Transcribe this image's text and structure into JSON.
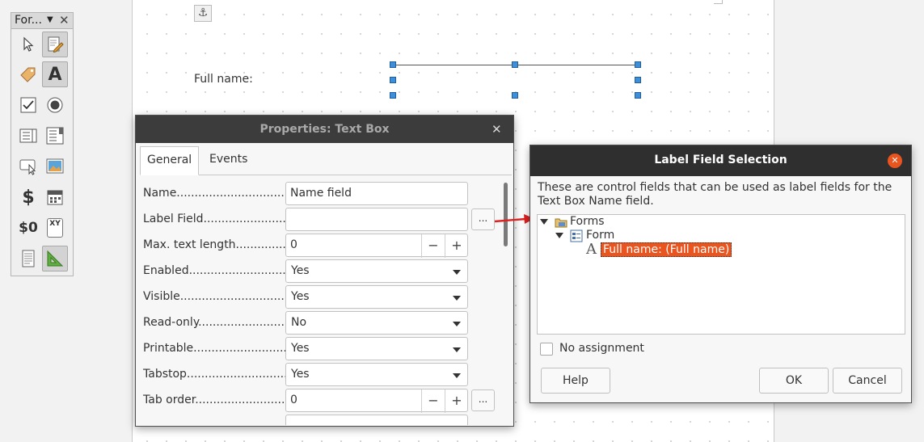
{
  "document": {
    "anchor_icon": "anchor-icon",
    "label_text": "Full name:"
  },
  "form_toolbar": {
    "title": "For...",
    "tools": [
      {
        "name": "select-icon",
        "pressed": false
      },
      {
        "name": "design-mode-icon",
        "pressed": true
      },
      {
        "name": "control-wizard-icon",
        "pressed": false
      },
      {
        "name": "label-icon",
        "pressed": true
      },
      {
        "name": "checkbox-icon",
        "pressed": false
      },
      {
        "name": "option-button-icon",
        "pressed": false
      },
      {
        "name": "list-box-icon",
        "pressed": false
      },
      {
        "name": "combo-box-icon",
        "pressed": false
      },
      {
        "name": "push-button-icon",
        "pressed": false
      },
      {
        "name": "image-button-icon",
        "pressed": false
      },
      {
        "name": "currency-field-icon",
        "pressed": false
      },
      {
        "name": "date-field-icon",
        "pressed": false
      },
      {
        "name": "numeric-field-icon",
        "pressed": false
      },
      {
        "name": "table-control-icon",
        "pressed": false
      },
      {
        "name": "form-properties-icon",
        "pressed": false
      },
      {
        "name": "navigator-icon",
        "pressed": true
      }
    ],
    "glyphs": {
      "currency": "$",
      "numeric": "$0",
      "xy": "XY"
    }
  },
  "properties_dialog": {
    "title": "Properties: Text Box",
    "tabs": [
      "General",
      "Events"
    ],
    "rows": [
      {
        "label": "Name.................................",
        "value": "Name field",
        "kind": "text"
      },
      {
        "label": "Label Field...........................",
        "value": "",
        "kind": "text-dots"
      },
      {
        "label": "Max. text length...............",
        "value": "0",
        "kind": "spin"
      },
      {
        "label": "Enabled.............................",
        "value": "Yes",
        "kind": "combo"
      },
      {
        "label": "Visible................................",
        "value": "Yes",
        "kind": "combo"
      },
      {
        "label": "Read-only...........................",
        "value": "No",
        "kind": "combo"
      },
      {
        "label": "Printable............................",
        "value": "Yes",
        "kind": "combo"
      },
      {
        "label": "Tabstop..............................",
        "value": "Yes",
        "kind": "combo"
      },
      {
        "label": "Tab order.............................",
        "value": "0",
        "kind": "spin-dots"
      }
    ],
    "dots_label": "...",
    "minus": "−",
    "plus": "+"
  },
  "label_dialog": {
    "title": "Label Field Selection",
    "description": "These are control fields that can be used as label fields for the Text Box Name field.",
    "tree": {
      "root": "Forms",
      "form": "Form",
      "item_glyph": "A",
      "item": "Full name: (Full name)"
    },
    "no_assignment": "No assignment",
    "buttons": {
      "help": "Help",
      "ok": "OK",
      "cancel": "Cancel"
    }
  },
  "colors": {
    "accent": "#e9541f",
    "handle": "#3c8fd8",
    "arrow": "#e02020"
  }
}
